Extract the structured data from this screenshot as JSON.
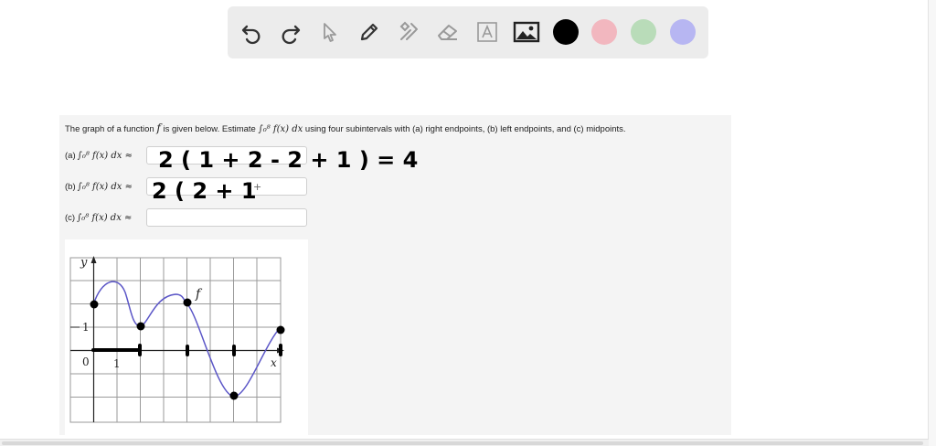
{
  "toolbar": {
    "tools": [
      {
        "name": "undo-icon"
      },
      {
        "name": "redo-icon"
      },
      {
        "name": "select-cursor-icon"
      },
      {
        "name": "pen-icon"
      },
      {
        "name": "tools-icon"
      },
      {
        "name": "eraser-icon"
      },
      {
        "name": "text-icon"
      },
      {
        "name": "image-icon"
      }
    ],
    "colors": [
      "#000000",
      "#f2b7bf",
      "#b9dcb9",
      "#b7b6f2"
    ]
  },
  "question": {
    "prefix": "The graph of a function",
    "var": "f",
    "middle": "is given below. Estimate",
    "integral": "∫₀⁸ f(x) dx",
    "suffix": "using four subintervals with (a) right endpoints, (b) left endpoints, and (c) midpoints."
  },
  "parts": [
    {
      "label": "(a)",
      "expr": "∫₀⁸ f(x) dx ≈",
      "handwriting": "2 ( 1 + 2 - 2 + 1 ) = 4"
    },
    {
      "label": "(b)",
      "expr": "∫₀⁸ f(x) dx ≈",
      "handwriting": "2 ( 2 + 1"
    },
    {
      "label": "(c)",
      "expr": "∫₀⁸ f(x) dx ≈",
      "handwriting": ""
    }
  ],
  "graph": {
    "y_label": "y",
    "x_label": "x",
    "origin_label": "0",
    "x_tick_label": "1",
    "y_tick_label": "1",
    "curve_label": "f"
  }
}
